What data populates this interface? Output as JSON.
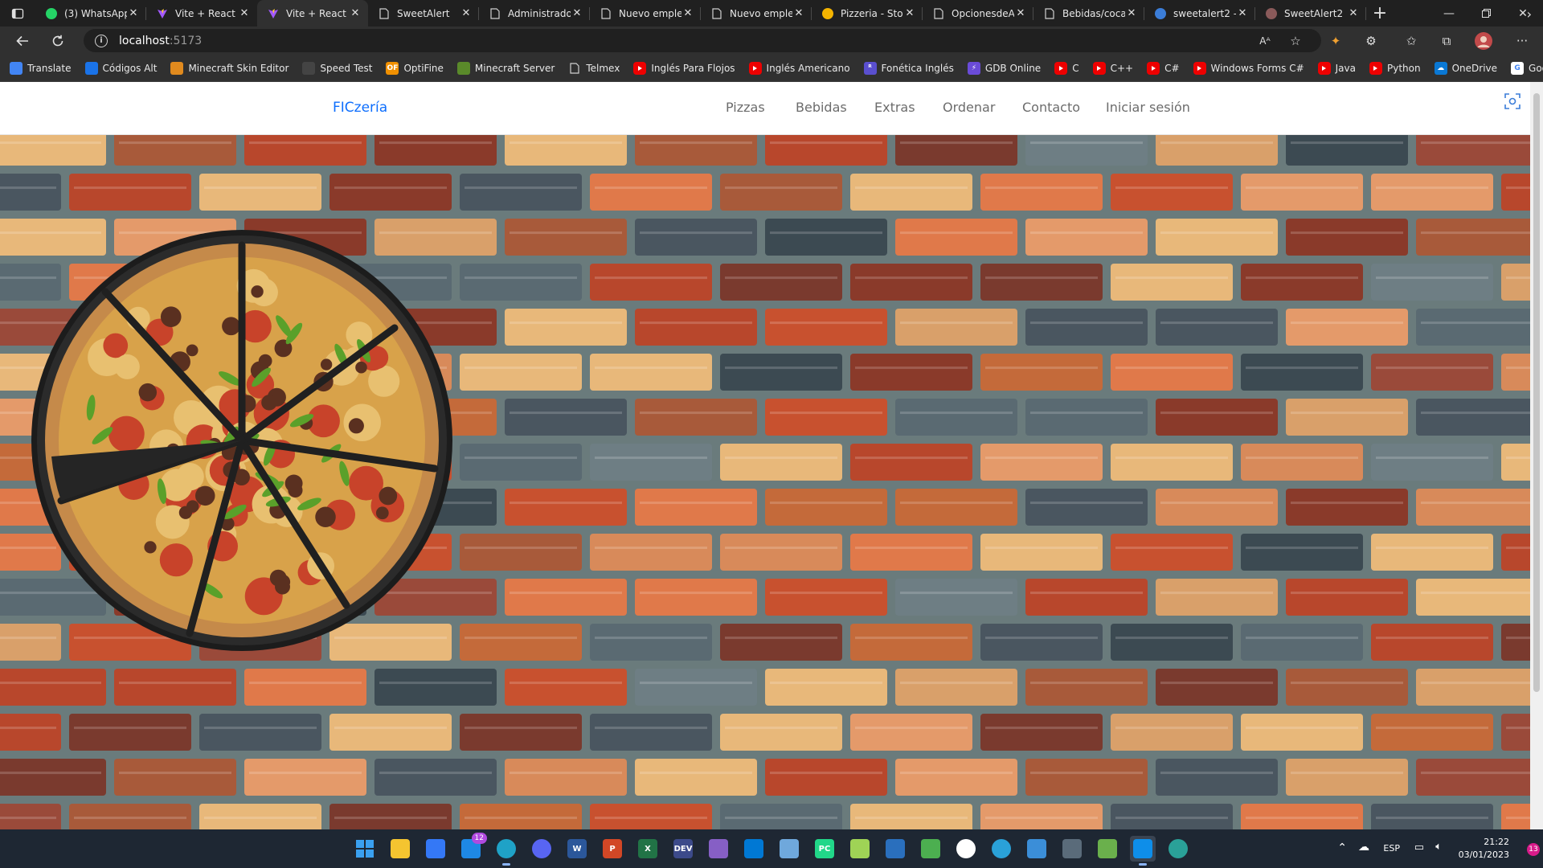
{
  "browser": {
    "tabs": [
      {
        "title": "(3) WhatsApp",
        "icon": "whatsapp-icon",
        "color": "#25d366"
      },
      {
        "title": "Vite + React",
        "icon": "vite-icon",
        "color": "#a259ff"
      },
      {
        "title": "Vite + React",
        "icon": "vite-icon",
        "color": "#a259ff",
        "active": true
      },
      {
        "title": "SweetAlert",
        "icon": "page-icon",
        "color": "#d0d0d0"
      },
      {
        "title": "Administrado",
        "icon": "page-icon",
        "color": "#d0d0d0"
      },
      {
        "title": "Nuevo emple",
        "icon": "page-icon",
        "color": "#d0d0d0"
      },
      {
        "title": "Nuevo emple",
        "icon": "page-icon",
        "color": "#d0d0d0"
      },
      {
        "title": "Pizzeria - Stor",
        "icon": "hand-icon",
        "color": "#f5b400"
      },
      {
        "title": "OpcionesdeA",
        "icon": "page-icon",
        "color": "#d0d0d0"
      },
      {
        "title": "Bebidas/coca",
        "icon": "page-icon",
        "color": "#d0d0d0"
      },
      {
        "title": "sweetalert2 -",
        "icon": "search-icon",
        "color": "#3b7dd8"
      },
      {
        "title": "SweetAlert2",
        "icon": "sweetalert-icon",
        "color": "#8a5a5a"
      }
    ],
    "url_host": "localhost",
    "url_port": ":5173",
    "favorites": [
      {
        "label": "Translate",
        "icon": "translate-icon",
        "color": "#4285f4"
      },
      {
        "label": "Códigos Alt",
        "icon": "heart-icon",
        "color": "#1a73e8"
      },
      {
        "label": "Minecraft Skin Editor",
        "icon": "minecraft-icon",
        "color": "#e08a1e"
      },
      {
        "label": "Speed Test",
        "icon": "speedometer-icon",
        "color": "#444444"
      },
      {
        "label": "OptiFine",
        "icon": "optifine-icon",
        "color": "#f09000",
        "glyph": "OF"
      },
      {
        "label": "Minecraft Server",
        "icon": "grass-block-icon",
        "color": "#5a8a2a"
      },
      {
        "label": "Telmex",
        "icon": "page-icon",
        "color": "#303030"
      },
      {
        "label": "Inglés Para Flojos",
        "icon": "youtube-icon",
        "color": "#e00000"
      },
      {
        "label": "Inglés Americano",
        "icon": "youtube-icon",
        "color": "#e00000"
      },
      {
        "label": "Fonética Inglés",
        "icon": "r-icon",
        "color": "#5a4fcf",
        "glyph": "ᴿ"
      },
      {
        "label": "GDB Online",
        "icon": "gdb-icon",
        "color": "#6a4bd8",
        "glyph": "⚡"
      },
      {
        "label": "C",
        "icon": "youtube-icon",
        "color": "#e00000"
      },
      {
        "label": "C++",
        "icon": "youtube-icon",
        "color": "#e00000"
      },
      {
        "label": "C#",
        "icon": "youtube-icon",
        "color": "#e00000"
      },
      {
        "label": "Windows Forms C#",
        "icon": "youtube-icon",
        "color": "#e00000"
      },
      {
        "label": "Java",
        "icon": "youtube-icon",
        "color": "#e00000"
      },
      {
        "label": "Python",
        "icon": "youtube-icon",
        "color": "#e00000"
      },
      {
        "label": "OneDrive",
        "icon": "onedrive-icon",
        "color": "#0a78d4",
        "glyph": "☁"
      },
      {
        "label": "Google",
        "icon": "google-icon",
        "color": "#ffffff",
        "glyph": "G"
      }
    ]
  },
  "site": {
    "brand": "FICzería",
    "nav": [
      "Pizzas",
      "Bebidas",
      "Extras",
      "Ordenar",
      "Contacto",
      "Iniciar sesión"
    ],
    "brand_color": "#0d6efd"
  },
  "taskbar": {
    "apps": [
      {
        "icon": "windows-start-icon",
        "color": "#3aa0f0"
      },
      {
        "icon": "file-explorer-icon",
        "color": "#f4c430"
      },
      {
        "icon": "microsoft-store-icon",
        "color": "#3478f6"
      },
      {
        "icon": "mail-icon",
        "color": "#1e88e5",
        "badge": "12"
      },
      {
        "icon": "edge-icon",
        "color": "#1fa2c7"
      },
      {
        "icon": "discord-icon",
        "color": "#5865f2"
      },
      {
        "icon": "word-icon",
        "color": "#2b579a",
        "glyph": "W"
      },
      {
        "icon": "powerpoint-icon",
        "color": "#d24726",
        "glyph": "P"
      },
      {
        "icon": "excel-icon",
        "color": "#217346",
        "glyph": "X"
      },
      {
        "icon": "devcpp-icon",
        "color": "#3c4a8a",
        "glyph": "DEV"
      },
      {
        "icon": "visual-studio-icon",
        "color": "#865fc5"
      },
      {
        "icon": "vscode-icon",
        "color": "#0078d4"
      },
      {
        "icon": "virtualbox-icon",
        "color": "#6fa8dc"
      },
      {
        "icon": "pycharm-icon",
        "color": "#21d789",
        "glyph": "PC"
      },
      {
        "icon": "netbeans-icon",
        "color": "#9fd356"
      },
      {
        "icon": "snipping-tool-icon",
        "color": "#2a6fbd"
      },
      {
        "icon": "paint-icon",
        "color": "#4caf50"
      },
      {
        "icon": "drawio-icon",
        "color": "#ffffff"
      },
      {
        "icon": "earth-icon",
        "color": "#2aa1d8"
      },
      {
        "icon": "notepad-icon",
        "color": "#3b8ed8"
      },
      {
        "icon": "calculator-icon",
        "color": "#5a6b7a"
      },
      {
        "icon": "minecraft-launcher-icon",
        "color": "#6ab04c"
      },
      {
        "icon": "teamviewer-icon",
        "color": "#0e8ee9"
      },
      {
        "icon": "edge-dev-icon",
        "color": "#2aa198"
      }
    ],
    "language": "ESP",
    "time": "21:22",
    "date": "03/01/2023",
    "notification_count": "13"
  }
}
